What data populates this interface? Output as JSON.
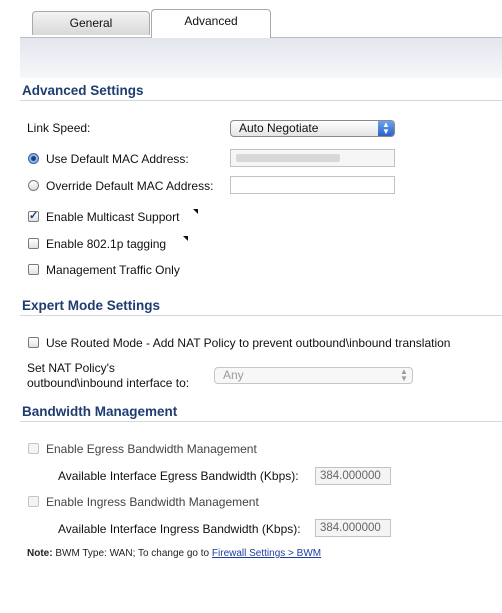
{
  "tabs": [
    {
      "label": "General",
      "active": false
    },
    {
      "label": "Advanced",
      "active": true
    }
  ],
  "advanced_settings": {
    "title": "Advanced Settings",
    "link_speed_label": "Link Speed:",
    "link_speed_value": "Auto Negotiate",
    "use_default_mac_label": "Use Default MAC Address:",
    "use_default_mac_selected": true,
    "override_mac_label": "Override Default MAC Address:",
    "override_mac_value": "",
    "multicast_label": "Enable Multicast Support",
    "multicast_checked": true,
    "tagging_label": "Enable 802.1p tagging",
    "tagging_checked": false,
    "mgmt_only_label": "Management Traffic Only",
    "mgmt_only_checked": false
  },
  "expert_mode": {
    "title": "Expert Mode Settings",
    "routed_mode_label": "Use Routed Mode - Add NAT Policy to prevent outbound\\inbound translation",
    "routed_mode_checked": false,
    "nat_policy_label_line1": "Set NAT Policy's",
    "nat_policy_label_line2": "outbound\\inbound interface to:",
    "nat_policy_value": "Any"
  },
  "bandwidth": {
    "title": "Bandwidth Management",
    "egress_label": "Enable Egress Bandwidth Management",
    "egress_checked": false,
    "egress_bw_label": "Available Interface Egress Bandwidth (Kbps):",
    "egress_bw_value": "384.000000",
    "ingress_label": "Enable Ingress Bandwidth Management",
    "ingress_checked": false,
    "ingress_bw_label": "Available Interface Ingress Bandwidth (Kbps):",
    "ingress_bw_value": "384.000000"
  },
  "note": {
    "prefix": "Note:",
    "text": " BWM Type: WAN; To change go to ",
    "link": "Firewall Settings > BWM"
  },
  "colors": {
    "section_title": "#1f3d6e",
    "select_arrow": "#2a63c8"
  }
}
